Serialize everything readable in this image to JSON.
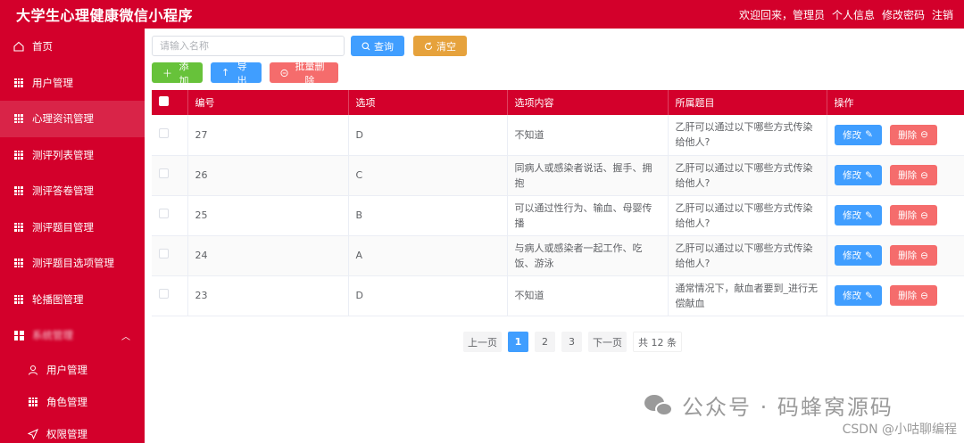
{
  "app": {
    "title": "大学生心理健康微信小程序",
    "welcome": "欢迎回来，管理员",
    "profile": "个人信息",
    "change_password": "修改密码",
    "logout": "注销"
  },
  "sidebar": {
    "items": [
      {
        "label": "首页",
        "icon": "home-icon"
      },
      {
        "label": "用户管理",
        "icon": "grid-icon"
      },
      {
        "label": "心理资讯管理",
        "icon": "grid-icon"
      },
      {
        "label": "测评列表管理",
        "icon": "grid-icon"
      },
      {
        "label": "测评答卷管理",
        "icon": "grid-icon"
      },
      {
        "label": "测评题目管理",
        "icon": "grid-icon"
      },
      {
        "label": "测评题目选项管理",
        "icon": "grid-icon"
      },
      {
        "label": "轮播图管理",
        "icon": "grid-icon"
      },
      {
        "label": "系统管理",
        "icon": "grid4-icon"
      }
    ],
    "subitems": [
      {
        "label": "用户管理",
        "icon": "user-icon"
      },
      {
        "label": "角色管理",
        "icon": "grid-icon"
      },
      {
        "label": "权限管理",
        "icon": "send-icon"
      }
    ]
  },
  "toolbar": {
    "search_placeholder": "请输入名称",
    "query": "查询",
    "clear": "清空",
    "add": "添加",
    "export": "导出",
    "batch_delete": "批量删除"
  },
  "table": {
    "headers": [
      "编号",
      "选项",
      "选项内容",
      "所属题目",
      "操作"
    ],
    "rows": [
      {
        "id": "27",
        "option": "D",
        "content": "不知道",
        "question": "乙肝可以通过以下哪些方式传染给他人?"
      },
      {
        "id": "26",
        "option": "C",
        "content": "同病人或感染者说话、握手、拥抱",
        "question": "乙肝可以通过以下哪些方式传染给他人?"
      },
      {
        "id": "25",
        "option": "B",
        "content": "可以通过性行为、输血、母婴传播",
        "question": "乙肝可以通过以下哪些方式传染给他人?"
      },
      {
        "id": "24",
        "option": "A",
        "content": "与病人或感染者一起工作、吃饭、游泳",
        "question": "乙肝可以通过以下哪些方式传染给他人?"
      },
      {
        "id": "23",
        "option": "D",
        "content": "不知道",
        "question": "通常情况下，献血者要到_进行无偿献血"
      }
    ],
    "edit_label": "修改",
    "delete_label": "删除"
  },
  "pagination": {
    "prev": "上一页",
    "pages": [
      "1",
      "2",
      "3"
    ],
    "next": "下一页",
    "total": "共 12 条"
  },
  "watermark": {
    "text": "公众号 · 码蜂窝源码",
    "csdn": "CSDN @小咕聊编程"
  }
}
